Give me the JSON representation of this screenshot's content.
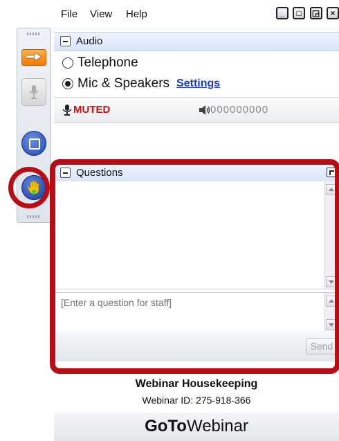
{
  "menu": {
    "file": "File",
    "view": "View",
    "help": "Help"
  },
  "window_buttons": [
    "minimize",
    "maximize",
    "restore",
    "close"
  ],
  "audio": {
    "title": "Audio",
    "options": [
      {
        "label": "Telephone",
        "selected": false
      },
      {
        "label": "Mic & Speakers",
        "selected": true
      }
    ],
    "settings_link": "Settings",
    "mute_status": "MUTED",
    "level_text": "000000000"
  },
  "questions": {
    "title": "Questions",
    "placeholder": "[Enter a question for staff]",
    "send_label": "Send"
  },
  "footer": {
    "title": "Webinar Housekeeping",
    "webinar_id": "Webinar ID: 275-918-366",
    "brand_bold": "GoTo",
    "brand_rest": "Webinar"
  },
  "colors": {
    "highlight": "#b90d15",
    "muted_red": "#d01010",
    "link_blue": "#1a3fc0"
  },
  "strip_icons": [
    "arrow-icon",
    "microphone-icon",
    "screen-share-icon",
    "raise-hand-icon"
  ]
}
